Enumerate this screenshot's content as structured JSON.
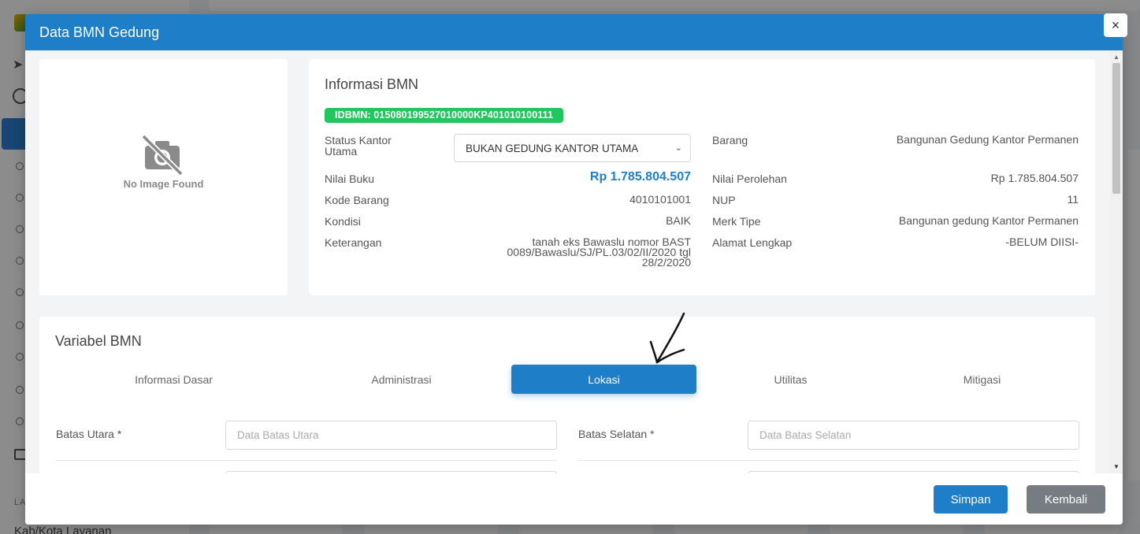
{
  "background": {
    "section_label": "LA",
    "bottom_item": "Kab/Kota Layanan"
  },
  "modal": {
    "title": "Data BMN Gedung",
    "close_label": "×"
  },
  "image_card": {
    "no_image_text": "No Image Found",
    "icon": "no-camera-icon"
  },
  "info": {
    "title": "Informasi BMN",
    "idbmn": "IDBMN: 015080199527010000KP401010100111",
    "left": {
      "status_label": "Status Kantor Utama",
      "status_value": "BUKAN GEDUNG KANTOR UTAMA",
      "nilai_buku_label": "Nilai Buku",
      "nilai_buku_value": "Rp 1.785.804.507",
      "kode_barang_label": "Kode Barang",
      "kode_barang_value": "4010101001",
      "kondisi_label": "Kondisi",
      "kondisi_value": "BAIK",
      "keterangan_label": "Keterangan",
      "keterangan_value": "tanah eks Bawaslu nomor BAST 0089/Bawaslu/SJ/PL.03/02/II/2020 tgl 28/2/2020"
    },
    "right": {
      "barang_label": "Barang",
      "barang_value": "Bangunan Gedung Kantor Permanen",
      "nilai_perolehan_label": "Nilai Perolehan",
      "nilai_perolehan_value": "Rp 1.785.804.507",
      "nup_label": "NUP",
      "nup_value": "11",
      "merk_label": "Merk Tipe",
      "merk_value": "Bangunan gedung Kantor Permanen",
      "alamat_label": "Alamat Lengkap",
      "alamat_value": "-BELUM DIISI-"
    }
  },
  "variabel": {
    "title": "Variabel BMN",
    "tabs": [
      {
        "label": "Informasi Dasar"
      },
      {
        "label": "Administrasi"
      },
      {
        "label": "Lokasi"
      },
      {
        "label": "Utilitas"
      },
      {
        "label": "Mitigasi"
      }
    ],
    "active_tab": "Lokasi",
    "fields": {
      "utara_label": "Batas Utara *",
      "utara_placeholder": "Data Batas Utara",
      "selatan_label": "Batas Selatan *",
      "selatan_placeholder": "Data Batas Selatan"
    }
  },
  "footer": {
    "save_label": "Simpan",
    "back_label": "Kembali"
  },
  "colors": {
    "primary": "#1e7ec8",
    "badge_green": "#22c55e",
    "secondary_button": "#777c82"
  }
}
